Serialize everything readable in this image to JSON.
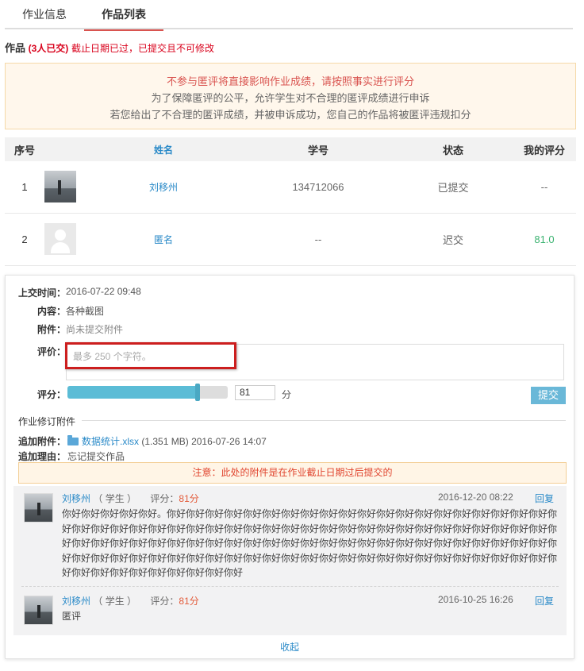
{
  "tabs": [
    {
      "label": "作业信息",
      "active": false
    },
    {
      "label": "作品列表",
      "active": true
    }
  ],
  "work_header": {
    "title": "作品",
    "count": "(3人已交)",
    "deadline_note": "截止日期已过，已提交且不可修改"
  },
  "notice": {
    "line1": "不参与匿评将直接影响作业成绩，请按照事实进行评分",
    "line2": "为了保障匿评的公平，允许学生对不合理的匿评成绩进行申诉",
    "line3": "若您给出了不合理的匿评成绩，并被申诉成功，您自己的作品将被匿评违规扣分"
  },
  "table": {
    "headers": {
      "no": "序号",
      "name": "姓名",
      "id": "学号",
      "status": "状态",
      "score": "我的评分"
    },
    "rows": [
      {
        "no": "1",
        "name": "刘移州",
        "id": "134712066",
        "status": "已提交",
        "score": "--"
      },
      {
        "no": "2",
        "name": "匿名",
        "id": "--",
        "status": "迟交",
        "score": "81.0"
      }
    ]
  },
  "detail": {
    "submit_time_label": "上交时间：",
    "submit_time": "2016-07-22 09:48",
    "content_label": "内容：",
    "content": "各种截图",
    "attachment_label": "附件：",
    "attachment": "尚未提交附件",
    "comment_label": "评价：",
    "comment_placeholder": "最多 250 个字符。",
    "score_label": "评分：",
    "score_value": "81",
    "score_fraction": 0.81,
    "score_unit": "分",
    "submit_button": "提交",
    "revision_title": "作业修订附件",
    "append_attachment_label": "追加附件：",
    "append_file_name": "数据统计.xlsx",
    "append_file_size": "(1.351 MB)",
    "append_file_time": "2016-07-26 14:07",
    "append_reason_label": "追加理由：",
    "append_reason": "忘记提交作品",
    "warning": "注意：此处的附件是在作业截止日期过后提交的",
    "collapse": "收起"
  },
  "comments": [
    {
      "name": "刘移州",
      "role": "（ 学生 ）",
      "score_label": "评分：",
      "score": "81分",
      "time": "2016-12-20 08:22",
      "reply": "回复",
      "body": "你好你好你好你好你好。你好你好你好你好你好你好你好你好你好你好你好你好你好你好你好你好你好你好你好你好你好你好你好你好你好你好你好你好你好你好你好你好你好你好你好你好你好你好你好你好你好你好你好你好你好你好你好你好你好你好你好你好你好你好你好你好你好你好你好你好你好你好你好你好你好你好你好你好你好你好你好你好你好你好你好你好你好你好你好你好你好你好你好你好你好你好你好你好你好你好你好你好你好你好你好你好你好你好你好你好你好你好你好你好你好你好你好你好"
    },
    {
      "name": "刘移州",
      "role": "（ 学生 ）",
      "score_label": "评分：",
      "score": "81分",
      "time": "2016-10-25 16:26",
      "reply": "回复",
      "body": "匿评"
    }
  ],
  "colors": {
    "accent_red": "#d9001b",
    "link_blue": "#2a8ac8",
    "slider_blue": "#5bbcd6",
    "tab_underline": "#d9534f"
  }
}
